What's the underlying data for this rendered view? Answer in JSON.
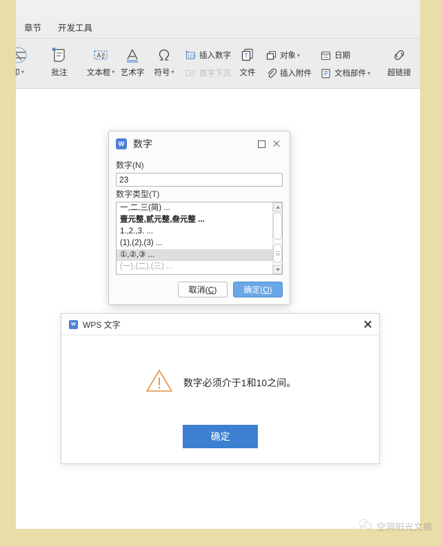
{
  "theme": {
    "page_border": "#e9dda8",
    "canvas": "#ffffff",
    "ribbon_bg": "#ececec",
    "accent_blue": "#3d7fd0",
    "dialog_primary": "#69a7e6",
    "warning_orange": "#e08f3c",
    "wps_logo_blue": "#4e7fd4"
  },
  "ribbon": {
    "tabs": [
      {
        "label": "章节",
        "name": "tab-chapters"
      },
      {
        "label": "开发工具",
        "name": "tab-developer-tools"
      }
    ],
    "groups": [
      {
        "buttons": [
          {
            "label": "印",
            "icon": "watermark-icon",
            "dropdown": true,
            "disabled": false,
            "clipped": true
          }
        ]
      },
      {
        "buttons": [
          {
            "label": "批注",
            "icon": "comment-icon",
            "dropdown": false,
            "disabled": false
          }
        ]
      },
      {
        "buttons": [
          {
            "label": "文本框",
            "icon": "textbox-icon",
            "dropdown": true,
            "disabled": false
          },
          {
            "label": "艺术字",
            "icon": "wordart-icon",
            "dropdown": false,
            "disabled": false
          },
          {
            "label": "符号",
            "icon": "symbol-omega-icon",
            "dropdown": true,
            "disabled": false
          }
        ],
        "stacks": [
          {
            "items": [
              {
                "label": "插入数字",
                "icon": "insert-number-icon",
                "disabled": false
              },
              {
                "label": "首字下沉",
                "icon": "drop-cap-icon",
                "disabled": true
              }
            ]
          },
          {
            "items": [
              {
                "label": "文件",
                "icon": "insert-file-icon",
                "disabled": false,
                "big": true
              }
            ]
          },
          {
            "items": [
              {
                "label": "对象",
                "icon": "object-icon",
                "disabled": false,
                "dropdown": true
              },
              {
                "label": "插入附件",
                "icon": "attachment-clip-icon",
                "disabled": false
              }
            ]
          },
          {
            "items": [
              {
                "label": "日期",
                "icon": "date-calendar-icon",
                "disabled": false
              },
              {
                "label": "文档部件",
                "icon": "document-parts-icon",
                "disabled": false,
                "dropdown": true
              }
            ]
          }
        ]
      },
      {
        "buttons": [
          {
            "label": "超链接",
            "icon": "hyperlink-icon",
            "dropdown": false,
            "disabled": false
          }
        ],
        "stacks": [
          {
            "items": [
              {
                "label": "",
                "icon": "quote-bracket-icon",
                "disabled": false
              },
              {
                "label": "",
                "icon": "bookmark-icon",
                "disabled": false
              }
            ]
          }
        ]
      }
    ]
  },
  "number_dialog": {
    "title": "数字",
    "logo_letter": "W",
    "maximize_label": "maximize",
    "close_label": "close",
    "number_field": {
      "label": "数字(N)",
      "accelerator": "N",
      "value": "23",
      "placeholder": ""
    },
    "type_field": {
      "label": "数字类型(T)",
      "accelerator": "T",
      "items": [
        {
          "text": "一,二,三(简) ...",
          "selected": false,
          "disabled": false,
          "bold": false
        },
        {
          "text": "壹元整,贰元整,叁元整 ...",
          "selected": false,
          "disabled": false,
          "bold": true
        },
        {
          "text": "1.,2.,3. ...",
          "selected": false,
          "disabled": false,
          "bold": false
        },
        {
          "text": "(1),(2),(3) ...",
          "selected": false,
          "disabled": false,
          "bold": false
        },
        {
          "text": "①,②,③ ...",
          "selected": true,
          "disabled": false,
          "bold": false
        },
        {
          "text": "(一),(二),(三) ...",
          "selected": false,
          "disabled": true,
          "bold": false
        }
      ]
    },
    "buttons": {
      "cancel": {
        "text": "取消",
        "accel": "C"
      },
      "ok": {
        "text": "确定",
        "accel": "O"
      }
    }
  },
  "message_box": {
    "title": "WPS 文字",
    "logo_letter": "W",
    "close_label": "close",
    "icon": "warning-triangle-icon",
    "text": "数字必须介于1和10之间。",
    "ok_label": "确定"
  },
  "watermark": {
    "icon": "wechat-icon",
    "text": "空洞阳光文摘"
  }
}
